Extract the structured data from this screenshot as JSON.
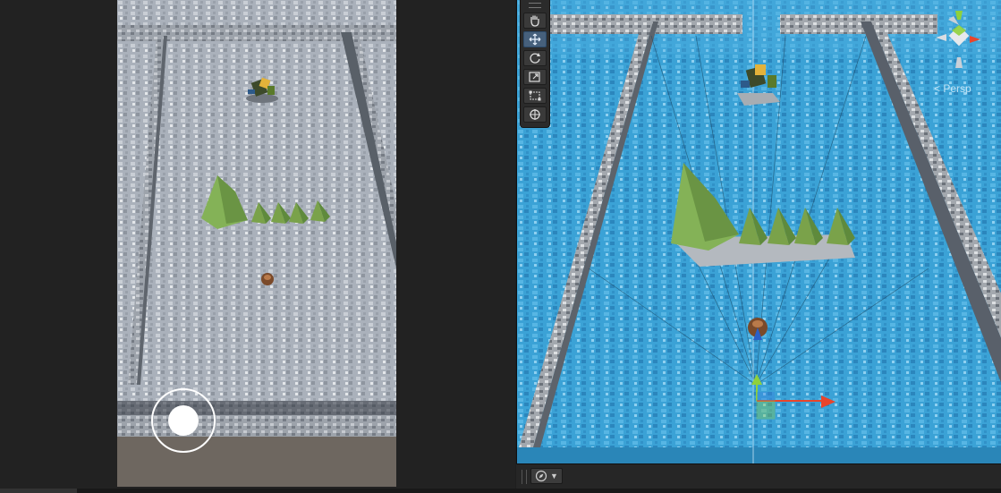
{
  "scene": {
    "projection_label": "< Persp",
    "tools": [
      {
        "name": "hand-tool",
        "active": false
      },
      {
        "name": "move-tool",
        "active": true
      },
      {
        "name": "rotate-tool",
        "active": false
      },
      {
        "name": "scale-tool",
        "active": false
      },
      {
        "name": "rect-tool",
        "active": false
      },
      {
        "name": "transform-tool",
        "active": false
      }
    ]
  },
  "game": {},
  "colors": {
    "editor_bg": "#1f1f1f",
    "scene_floor": "#3b9ed0",
    "game_floor": "#a9b0ba",
    "wall": "#8e949c",
    "tree": "#7aa24a",
    "gizmo_x": "#e8452c",
    "gizmo_y": "#8fd13c",
    "gizmo_z": "#3a7fe0",
    "active_tool": "#46607c"
  }
}
